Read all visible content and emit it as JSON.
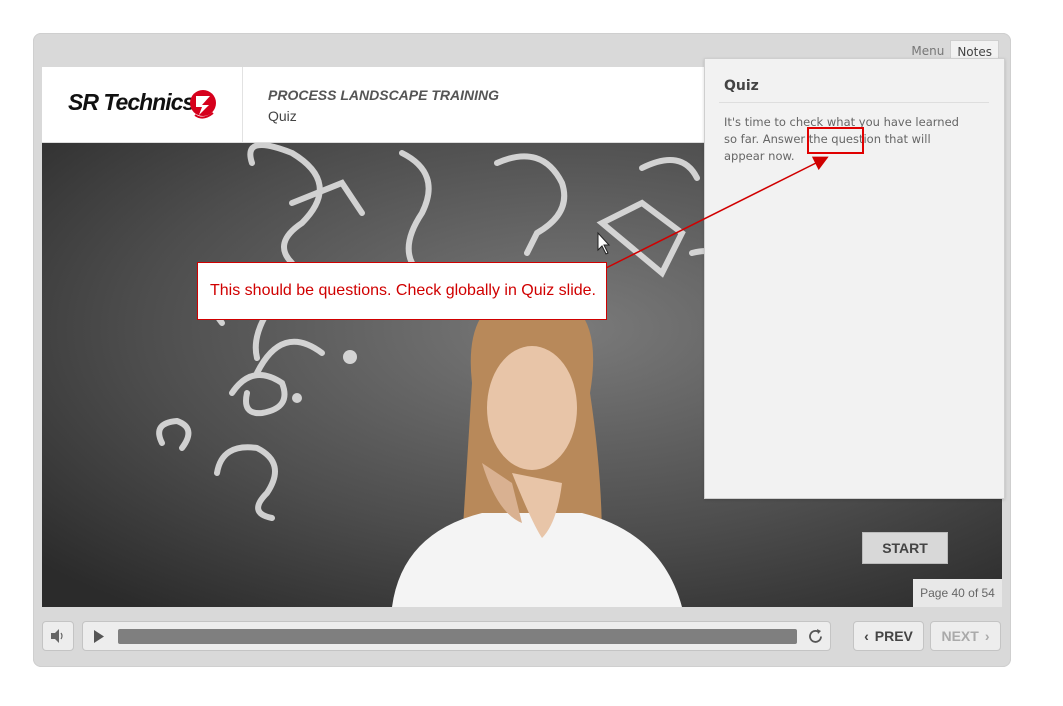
{
  "tabs": {
    "menu": "Menu",
    "notes": "Notes"
  },
  "header": {
    "logo": "SR Technics",
    "course_title": "PROCESS LANDSCAPE TRAINING",
    "slide_name": "Quiz"
  },
  "notes_panel": {
    "title": "Quiz",
    "text": "It's time to check what you have learned so far. Answer the question that will appear now."
  },
  "annotation": {
    "callout_text": "This should be questions. Check globally in Quiz slide.",
    "color": "#d00000"
  },
  "slide": {
    "start_label": "START",
    "page_counter": "Page 40 of 54"
  },
  "controls": {
    "prev_label": "PREV",
    "next_label": "NEXT",
    "volume_icon": "speaker-icon",
    "play_icon": "play-icon",
    "replay_icon": "replay-icon"
  }
}
